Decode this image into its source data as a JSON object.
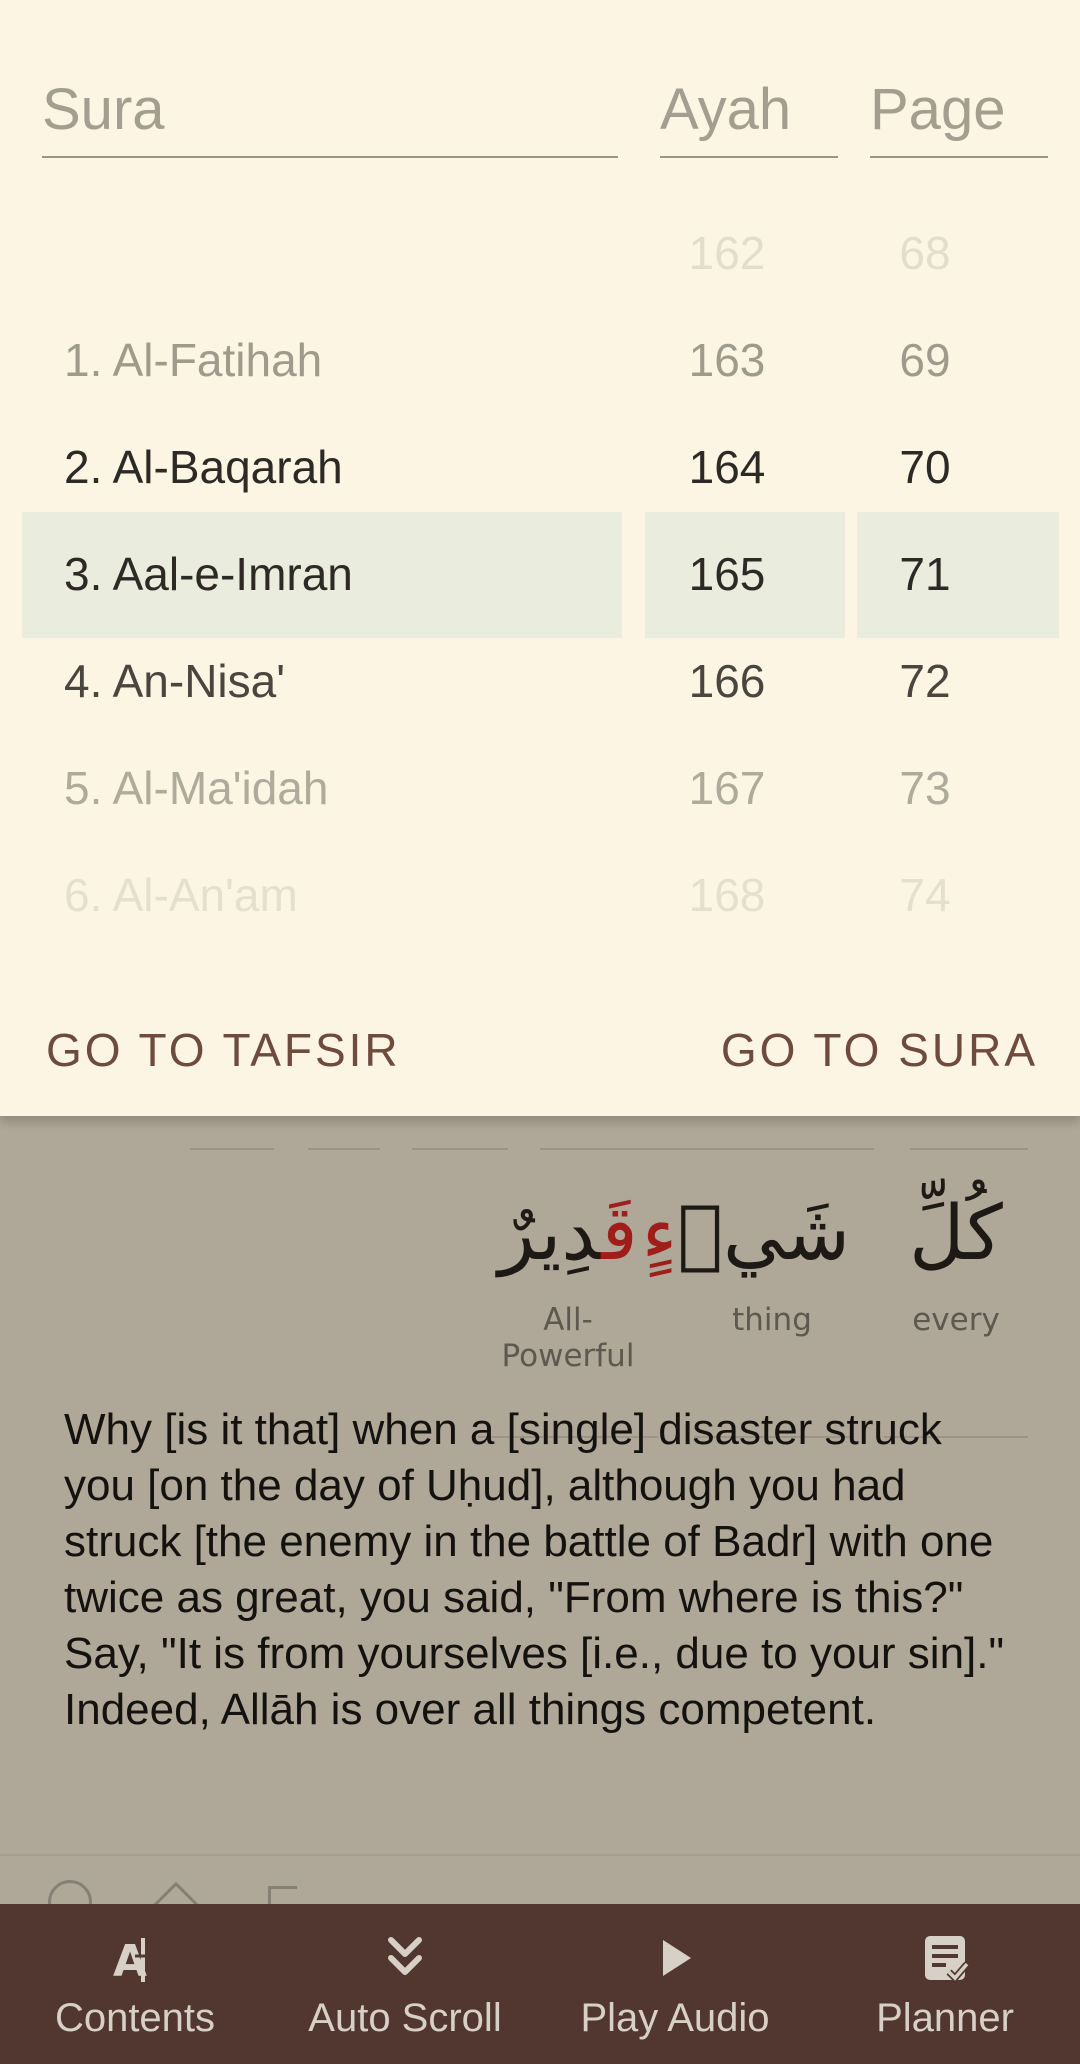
{
  "picker": {
    "headers": {
      "sura": "Sura",
      "ayah": "Ayah",
      "page": "Page"
    },
    "rows": [
      {
        "sura": "",
        "ayah": "162",
        "page": "68"
      },
      {
        "sura": "1. Al-Fatihah",
        "ayah": "163",
        "page": "69"
      },
      {
        "sura": "2. Al-Baqarah",
        "ayah": "164",
        "page": "70"
      },
      {
        "sura": "3. Aal-e-Imran",
        "ayah": "165",
        "page": "71"
      },
      {
        "sura": "4. An-Nisa'",
        "ayah": "166",
        "page": "72"
      },
      {
        "sura": "5. Al-Ma'idah",
        "ayah": "167",
        "page": "73"
      },
      {
        "sura": "6. Al-An'am",
        "ayah": "168",
        "page": "74"
      }
    ],
    "selected": {
      "sura": "3. Aal-e-Imran",
      "ayah": "165",
      "page": "71"
    }
  },
  "actions": {
    "tafsir": "GO TO TAFSIR",
    "sura": "GO TO SURA"
  },
  "words": [
    {
      "arabic_main": "قَ",
      "arabic_rest": "دِيرٌ",
      "gloss": "All-Powerful"
    },
    {
      "arabic_main": "شَيۡ",
      "arabic_rest": "ءٍ",
      "gloss": "thing"
    },
    {
      "arabic_main": "كُلِّ",
      "arabic_rest": "",
      "gloss": "every"
    }
  ],
  "translation": "Why [is it that] when a [single] disaster struck you [on the day of Uḥud], although you had struck [the enemy in the battle of Badr] with one twice as great, you said, \"From where is this?\" Say, \"It is from yourselves [i.e., due to your sin].\" Indeed, Allāh is over all things competent.",
  "bottom_nav": [
    {
      "label": "Contents",
      "icon": "contents-icon"
    },
    {
      "label": "Auto Scroll",
      "icon": "auto-scroll-icon"
    },
    {
      "label": "Play Audio",
      "icon": "play-icon"
    },
    {
      "label": "Planner",
      "icon": "planner-icon"
    }
  ],
  "colors": {
    "sheet_bg": "#fcf5e3",
    "selection_band": "#eaeddd",
    "action_text": "#6e4b3c",
    "nav_bg": "#51372f",
    "arabic_highlight": "#a01e1a"
  }
}
